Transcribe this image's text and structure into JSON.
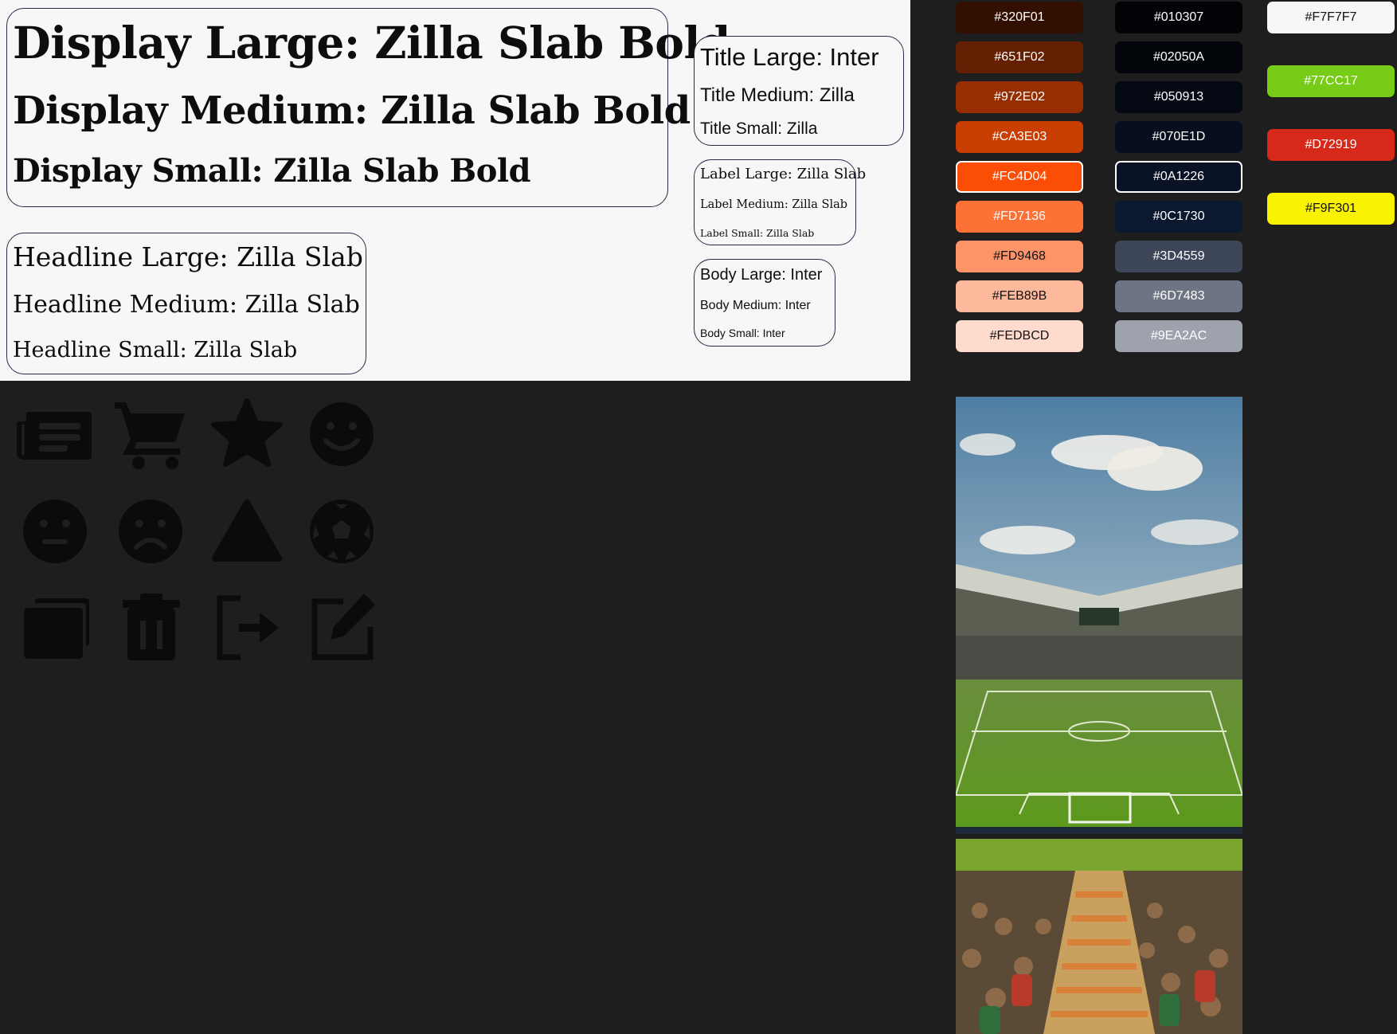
{
  "typography": {
    "display": {
      "large": "Display Large: Zilla Slab Bold",
      "medium": "Display Medium: Zilla Slab Bold",
      "small": "Display Small: Zilla Slab Bold"
    },
    "headline": {
      "large": "Headline Large: Zilla Slab",
      "medium": "Headline Medium: Zilla Slab",
      "small": "Headline Small: Zilla Slab"
    },
    "title": {
      "large": "Title Large: Inter",
      "medium": "Title Medium: Zilla",
      "small": "Title Small: Zilla"
    },
    "label": {
      "large": "Label Large: Zilla Slab",
      "medium": "Label Medium: Zilla Slab",
      "small": "Label Small: Zilla Slab"
    },
    "body": {
      "large": "Body Large: Inter",
      "medium": "Body Medium: Inter",
      "small": "Body Small: Inter"
    }
  },
  "palette": {
    "orange": [
      "#320F01",
      "#651F02",
      "#972E02",
      "#CA3E03",
      "#FC4D04",
      "#FD7136",
      "#FD9468",
      "#FEB89B",
      "#FEDBCD"
    ],
    "navy": [
      "#010307",
      "#02050A",
      "#050913",
      "#070E1D",
      "#0A1226",
      "#0C1730",
      "#3D4559",
      "#6D7483",
      "#9EA2AC"
    ],
    "accents": [
      "#F7F7F7",
      "#77CC17",
      "#D72919",
      "#F9F301"
    ]
  },
  "icons": [
    "newspaper-icon",
    "shopping-cart-icon",
    "star-icon",
    "smile-icon",
    "neutral-face-icon",
    "sad-face-icon",
    "triangle-icon",
    "soccer-ball-icon",
    "layers-icon",
    "trash-icon",
    "logout-icon",
    "edit-icon"
  ]
}
